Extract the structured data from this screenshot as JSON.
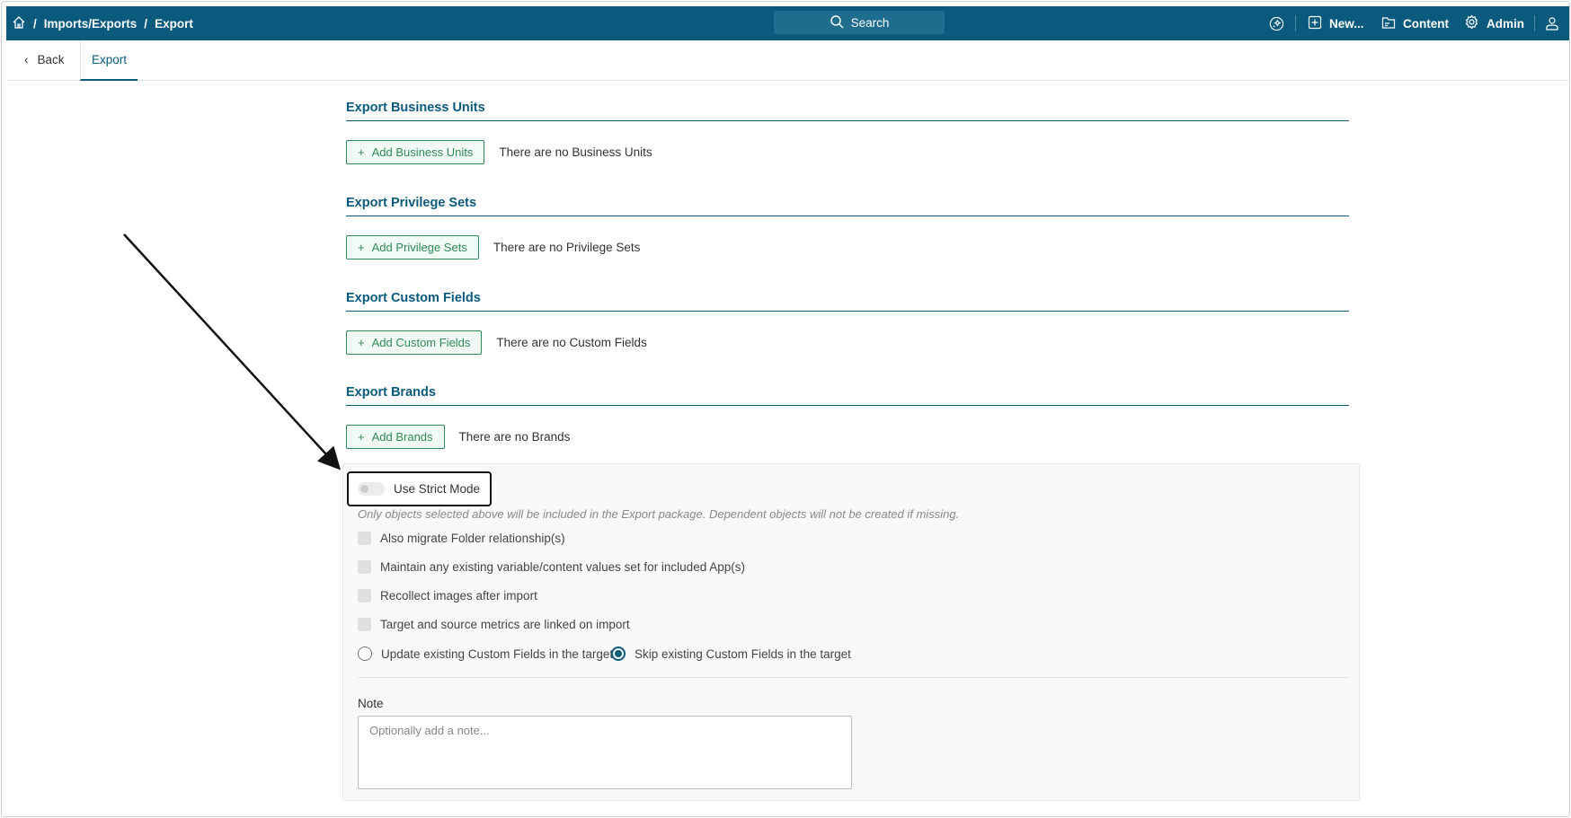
{
  "topbar": {
    "breadcrumb": [
      "Imports/Exports",
      "Export"
    ],
    "separator": "/",
    "search_label": "Search",
    "new_label": "New...",
    "content_label": "Content",
    "admin_label": "Admin"
  },
  "subbar": {
    "back_label": "Back",
    "tab_label": "Export"
  },
  "sections": [
    {
      "title": "Export Business Units",
      "button": "Add Business Units",
      "empty": "There are no Business Units"
    },
    {
      "title": "Export Privilege Sets",
      "button": "Add Privilege Sets",
      "empty": "There are no Privilege Sets"
    },
    {
      "title": "Export Custom Fields",
      "button": "Add Custom Fields",
      "empty": "There are no Custom Fields"
    },
    {
      "title": "Export Brands",
      "button": "Add Brands",
      "empty": "There are no Brands"
    }
  ],
  "options": {
    "strict_mode_label": "Use Strict Mode",
    "strict_mode_on": false,
    "hint": "Only objects selected above will be included in the Export package. Dependent objects will not be created if missing.",
    "checkboxes": [
      "Also migrate Folder relationship(s)",
      "Maintain any existing variable/content values set for included App(s)",
      "Recollect images after import",
      "Target and source metrics are linked on import"
    ],
    "radio_update": "Update existing Custom Fields in the target",
    "radio_skip": "Skip existing Custom Fields in the target",
    "radio_selected": "skip",
    "note_label": "Note",
    "note_placeholder": "Optionally add a note...",
    "note_value": ""
  },
  "colors": {
    "brand": "#0a5a7e",
    "button_green": "#2e8b57"
  }
}
